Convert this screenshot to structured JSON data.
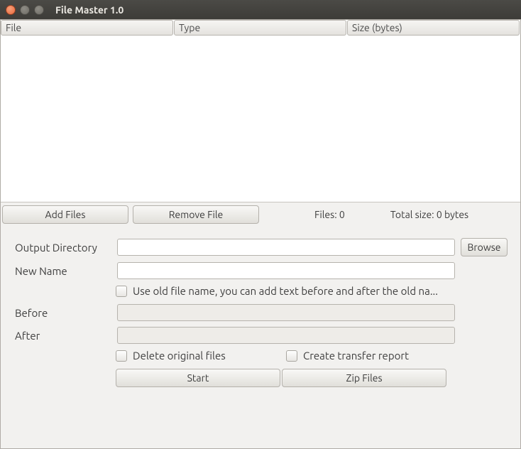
{
  "window": {
    "title": "File Master 1.0"
  },
  "table": {
    "columns": {
      "file": "File",
      "type": "Type",
      "size": "Size (bytes)"
    },
    "rows": []
  },
  "toolbar": {
    "add_files": "Add Files",
    "remove_file": "Remove File",
    "files_label": "Files:",
    "files_count": "0",
    "total_label": "Total size:",
    "total_value": "0 bytes"
  },
  "form": {
    "output_dir_label": "Output Directory",
    "output_dir_value": "",
    "browse": "Browse",
    "new_name_label": "New Name",
    "new_name_value": "",
    "use_old_label": "Use old file name, you can add text before and after the old na...",
    "before_label": "Before",
    "before_value": "",
    "after_label": "After",
    "after_value": "",
    "delete_label": "Delete original files",
    "report_label": "Create transfer report",
    "start": "Start",
    "zip": "Zip Files"
  }
}
